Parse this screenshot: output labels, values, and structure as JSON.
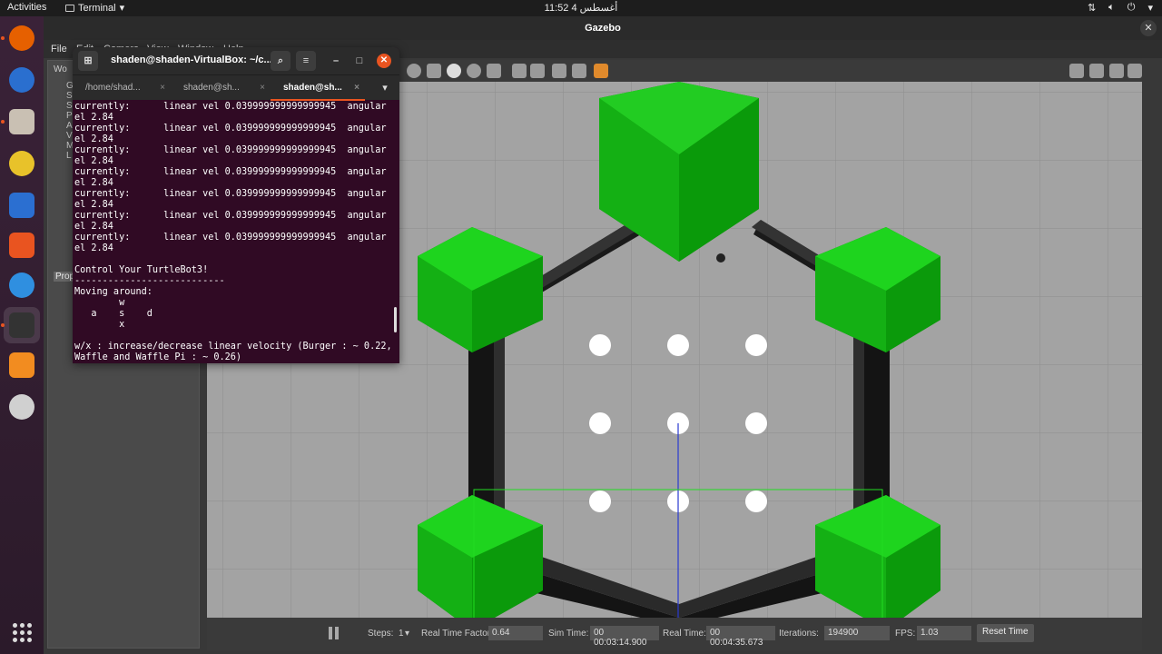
{
  "topbar": {
    "activities": "Activities",
    "app_name": "Terminal",
    "clock": "11:52  أغسطس 4"
  },
  "dock": {
    "items": [
      {
        "name": "firefox-icon",
        "color": "#e66000"
      },
      {
        "name": "thunderbird-icon",
        "color": "#2a6fcf"
      },
      {
        "name": "files-icon",
        "color": "#c9c0b3"
      },
      {
        "name": "rhythmbox-icon",
        "color": "#e8c22a"
      },
      {
        "name": "libreoffice-writer-icon",
        "color": "#2b6fd1"
      },
      {
        "name": "software-center-icon",
        "color": "#e95420"
      },
      {
        "name": "help-icon",
        "color": "#2f8fe0"
      },
      {
        "name": "terminal-icon",
        "color": "#333333"
      },
      {
        "name": "sublime-text-icon",
        "color": "#f28c20"
      },
      {
        "name": "dvd-icon",
        "color": "#d0d0d0"
      }
    ],
    "apps_grid_icon": "show-applications-icon"
  },
  "gazebo": {
    "title": "Gazebo",
    "menu": [
      "File",
      "Edit",
      "Camera",
      "View",
      "Window",
      "Help"
    ],
    "left_panel": {
      "tab": "Wo",
      "tree_letters": [
        "G",
        "S",
        "S",
        "P",
        "A",
        "V",
        "M",
        "L"
      ],
      "properties_label": "Prop"
    },
    "bottom": {
      "steps_label": "Steps:",
      "steps_value": "1",
      "rtf_label": "Real Time Factor:",
      "rtf_value": "0.64",
      "sim_time_label": "Sim Time:",
      "sim_time_value": "00 00:03:14.900",
      "real_time_label": "Real Time:",
      "real_time_value": "00 00:04:35.673",
      "iterations_label": "Iterations:",
      "iterations_value": "194900",
      "fps_label": "FPS:",
      "fps_value": "1.03",
      "reset_button": "Reset Time"
    }
  },
  "terminal": {
    "title": "shaden@shaden-VirtualBox: ~/c...",
    "tabs": [
      {
        "label": "/home/shad..."
      },
      {
        "label": "shaden@sh..."
      },
      {
        "label": "shaden@sh...",
        "active": true
      }
    ],
    "lines": [
      "currently:      linear vel 0.039999999999999945  angular v",
      "el 2.84",
      "currently:      linear vel 0.039999999999999945  angular v",
      "el 2.84",
      "currently:      linear vel 0.039999999999999945  angular v",
      "el 2.84",
      "currently:      linear vel 0.039999999999999945  angular v",
      "el 2.84",
      "currently:      linear vel 0.039999999999999945  angular v",
      "el 2.84",
      "currently:      linear vel 0.039999999999999945  angular v",
      "el 2.84",
      "currently:      linear vel 0.039999999999999945  angular v",
      "el 2.84",
      "",
      "Control Your TurtleBot3!",
      "---------------------------",
      "Moving around:",
      "        w",
      "   a    s    d",
      "        x",
      "",
      "w/x : increase/decrease linear velocity (Burger : ~ 0.22,",
      "Waffle and Waffle Pi : ~ 0.26)"
    ]
  }
}
